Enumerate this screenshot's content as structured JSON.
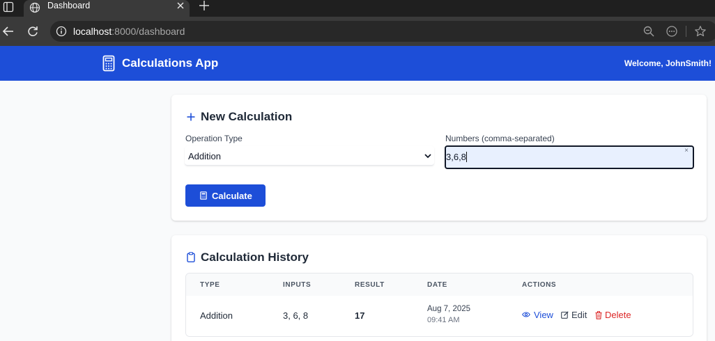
{
  "browser": {
    "tab_title": "Dashboard",
    "url_host": "localhost",
    "url_rest": ":8000/dashboard"
  },
  "app": {
    "title": "Calculations App",
    "welcome": "Welcome, JohnSmith!",
    "brand_color": "#1d4ed8"
  },
  "new_calculation": {
    "title": "New Calculation",
    "operation_label": "Operation Type",
    "operation_value": "Addition",
    "numbers_label": "Numbers (comma-separated)",
    "numbers_value": "3,6,8",
    "clear_symbol": "×",
    "button_label": "Calculate"
  },
  "history": {
    "title": "Calculation History",
    "columns": [
      "TYPE",
      "INPUTS",
      "RESULT",
      "DATE",
      "ACTIONS"
    ],
    "rows": [
      {
        "type": "Addition",
        "inputs": "3, 6, 8",
        "result": "17",
        "date": "Aug 7, 2025",
        "time": "09:41 AM",
        "actions": {
          "view": "View",
          "edit": "Edit",
          "delete": "Delete"
        }
      }
    ]
  },
  "colors": {
    "view": "#1d4ed8",
    "edit": "#374151",
    "delete": "#dc2626"
  },
  "icons": {
    "tab": "globe-icon",
    "header": "calculator-icon",
    "new_calc": "plus-icon",
    "history": "clipboard-icon"
  }
}
